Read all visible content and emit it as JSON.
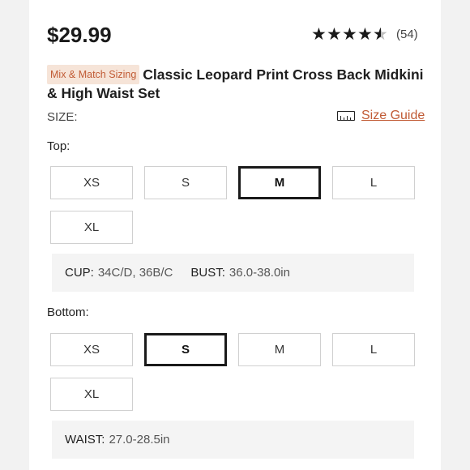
{
  "product": {
    "price": "$29.99",
    "rating_count": "(54)",
    "rating_value": 4.5,
    "badge": "Mix & Match Sizing",
    "title": "Classic Leopard Print Cross Back Midkini & High Waist Set"
  },
  "size_header": {
    "label": "SIZE:",
    "guide_label": "Size Guide",
    "guide_icon": "ruler-icon"
  },
  "top": {
    "label": "Top:",
    "sizes": [
      "XS",
      "S",
      "M",
      "L",
      "XL"
    ],
    "selected": "M",
    "measurements": [
      {
        "label": "CUP:",
        "value": "34C/D, 36B/C"
      },
      {
        "label": "BUST:",
        "value": "36.0-38.0in"
      }
    ]
  },
  "bottom": {
    "label": "Bottom:",
    "sizes": [
      "XS",
      "S",
      "M",
      "L",
      "XL"
    ],
    "selected": "S",
    "measurements": [
      {
        "label": "WAIST:",
        "value": "27.0-28.5in"
      }
    ]
  },
  "colors": {
    "accent": "#c15b35",
    "badge_bg": "#f6e4d8",
    "selected_border": "#1a1a1a"
  }
}
